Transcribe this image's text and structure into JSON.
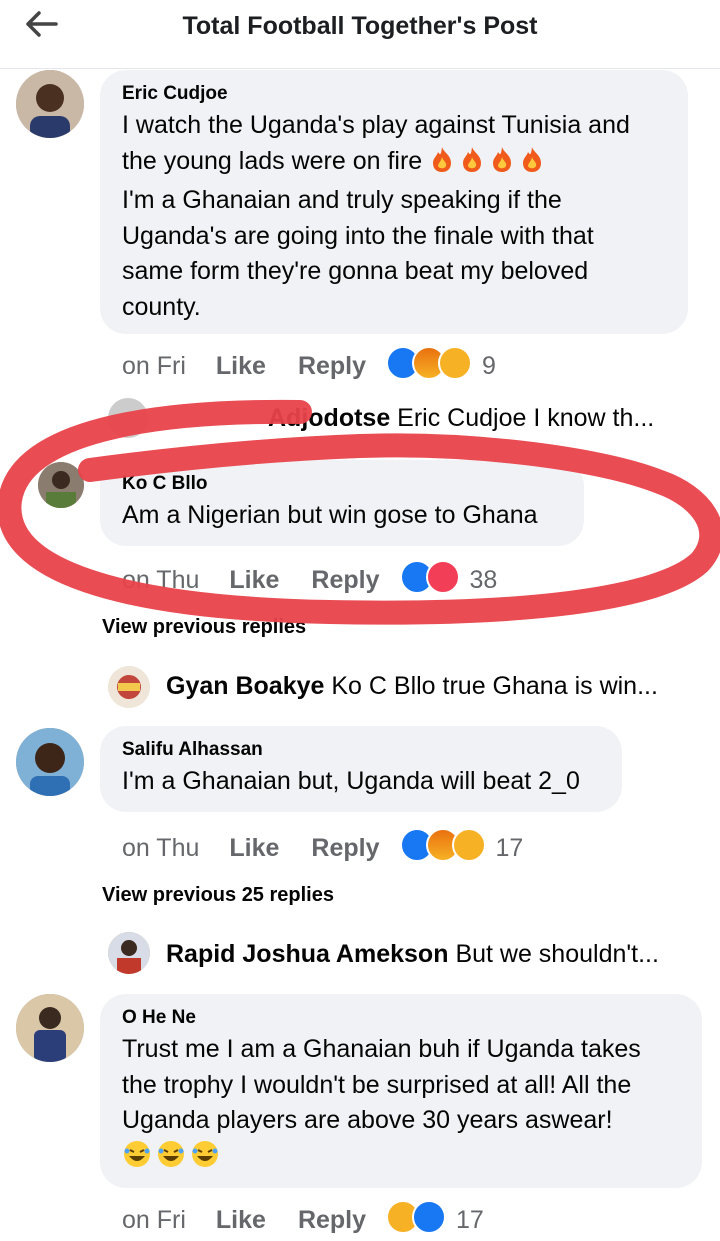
{
  "header": {
    "title": "Total Football Together's Post"
  },
  "comments": [
    {
      "name": "Eric Cudjoe",
      "lines": [
        "I watch the Uganda's play against Tunisia and",
        "the young lads were on fire",
        "I'm a Ghanaian and truly speaking if the",
        "Uganda's are going into the finale with that",
        "same form they're gonna beat my beloved",
        "county."
      ],
      "time": "on Fri",
      "like": "Like",
      "reply": "Reply",
      "count": "9"
    },
    {
      "name": "Ko C Bllo",
      "lines": [
        "Am a Nigerian but win gose to Ghana"
      ],
      "time": "on Thu",
      "like": "Like",
      "reply": "Reply",
      "count": "38"
    },
    {
      "name": "Salifu Alhassan",
      "lines": [
        "I'm a Ghanaian but, Uganda will beat 2_0"
      ],
      "time": "on Thu",
      "like": "Like",
      "reply": "Reply",
      "count": "17"
    },
    {
      "name": "O He Ne",
      "lines": [
        "Trust me I am a Ghanaian buh if Uganda takes",
        "the trophy I wouldn't be surprised at all! All the",
        "Uganda players are above 30 years aswear!"
      ],
      "time": "on Fri",
      "like": "Like",
      "reply": "Reply",
      "count": "17"
    }
  ],
  "replies": [
    {
      "name": "Adjodotse",
      "text": "Eric Cudjoe I know th..."
    },
    {
      "name": "Gyan Boakye",
      "text": "Ko C Bllo true Ghana is win..."
    },
    {
      "name": "Rapid Joshua Amekson",
      "text": "But we shouldn't..."
    }
  ],
  "view_previous": [
    "View previous replies",
    "View previous 25 replies"
  ],
  "colors": {
    "annotation": "#e8424a",
    "bubble": "#f0f2f5",
    "meta": "#65676b",
    "like_blue": "#1877f2"
  }
}
